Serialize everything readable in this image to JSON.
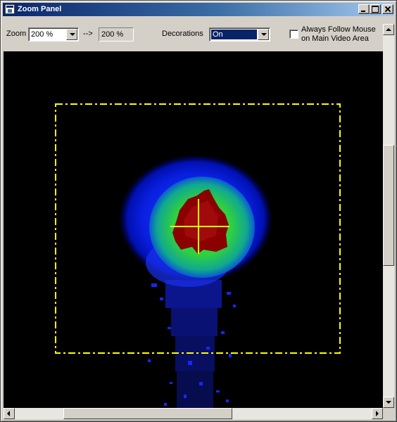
{
  "window": {
    "title": "Zoom Panel"
  },
  "toolbar": {
    "zoom_label": "Zoom",
    "zoom_value": "200 %",
    "arrow_text": "-->",
    "effective_zoom": "200 %",
    "decorations_label": "Decorations",
    "decorations_value": "On",
    "follow_mouse_label_line1": "Always Follow Mouse",
    "follow_mouse_label_line2": "on Main Video Area",
    "follow_mouse_checked": false
  },
  "colors": {
    "overlay": "#ffff00",
    "title_gradient_start": "#0a246a",
    "title_gradient_end": "#a6caf0",
    "intensity_high": "#8b0000",
    "intensity_mid": "#00cc00",
    "intensity_low": "#0000ff"
  },
  "icons": [
    "window-icon",
    "minimize-icon",
    "maximize-icon",
    "close-icon",
    "chevron-down-icon",
    "arrow-up-icon",
    "arrow-down-icon",
    "arrow-left-icon",
    "arrow-right-icon"
  ]
}
